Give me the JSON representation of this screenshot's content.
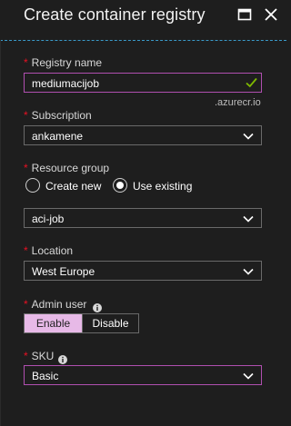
{
  "header": {
    "title": "Create container registry",
    "maximize_icon": "maximize-icon",
    "close_icon": "close-icon"
  },
  "registry_name": {
    "label": "Registry name",
    "value": "mediumacijob",
    "suffix": ".azurecr.io",
    "valid_icon": "checkmark-icon"
  },
  "subscription": {
    "label": "Subscription",
    "value": "ankamene"
  },
  "resource_group": {
    "label": "Resource group",
    "options": [
      "Create new",
      "Use existing"
    ],
    "selected": "Use existing",
    "value": "aci-job"
  },
  "location": {
    "label": "Location",
    "value": "West Europe"
  },
  "admin_user": {
    "label": "Admin user",
    "options": [
      "Enable",
      "Disable"
    ],
    "selected": "Enable"
  },
  "sku": {
    "label": "SKU",
    "value": "Basic"
  },
  "colors": {
    "accent": "#b04fb0",
    "required_star": "#e81123",
    "valid_check": "#7fba00",
    "toggle_selected": "#e7b9e7",
    "divider": "#3a9ac9"
  }
}
